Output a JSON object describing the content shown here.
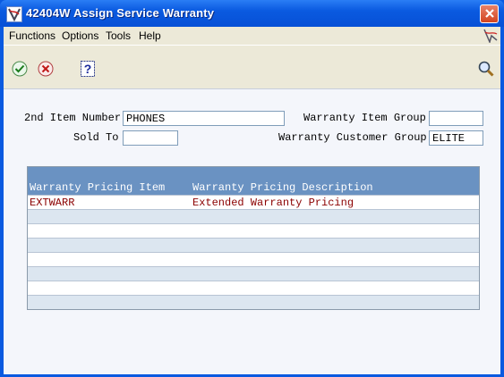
{
  "window": {
    "title": "42404W   Assign Service Warranty"
  },
  "menu": {
    "items": [
      "Functions",
      "Options",
      "Tools",
      "Help"
    ]
  },
  "form": {
    "item_number_label": "2nd Item Number",
    "item_number_value": "PHONES",
    "sold_to_label": "Sold To",
    "sold_to_value": "",
    "warranty_item_group_label": "Warranty Item Group",
    "warranty_item_group_value": "",
    "warranty_customer_group_label": "Warranty Customer Group",
    "warranty_customer_group_value": "ELITE"
  },
  "grid": {
    "columns": [
      "Warranty Pricing Item",
      "Warranty Pricing Description"
    ],
    "rows": [
      {
        "item": "EXTWARR",
        "description": "Extended Warranty Pricing"
      }
    ]
  },
  "colors": {
    "title_bar": "#0a5ae0",
    "grid_header": "#6a92c2",
    "row_text": "#8b0000",
    "alt_row": "#dce6f0"
  }
}
